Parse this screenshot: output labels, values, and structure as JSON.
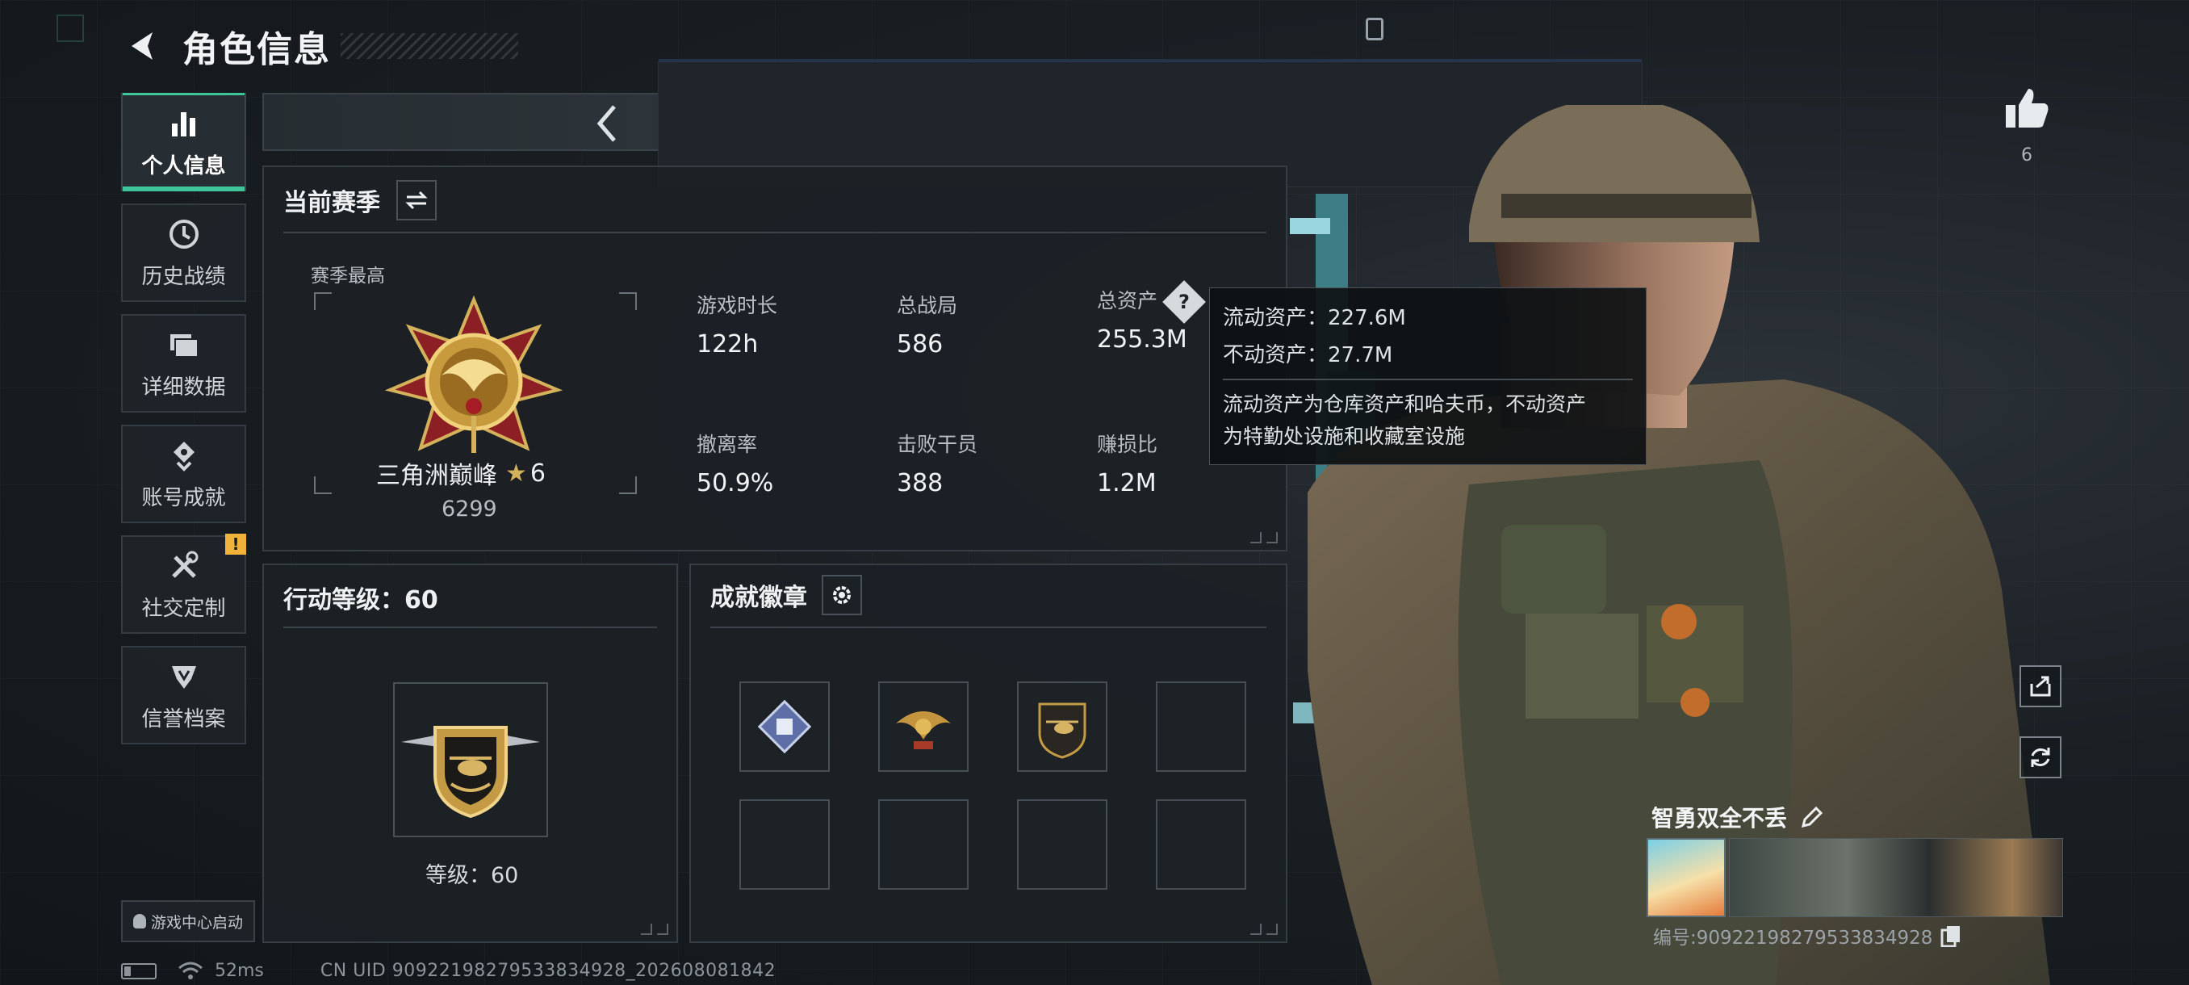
{
  "header": {
    "title": "角色信息"
  },
  "sidebar": {
    "items": [
      {
        "label": "个人信息",
        "icon": "bar-chart-icon",
        "active": true
      },
      {
        "label": "历史战绩",
        "icon": "history-icon"
      },
      {
        "label": "详细数据",
        "icon": "folder-icon"
      },
      {
        "label": "账号成就",
        "icon": "medal-icon"
      },
      {
        "label": "社交定制",
        "icon": "tools-icon",
        "badge": "!"
      },
      {
        "label": "信誉档案",
        "icon": "shield-icon"
      }
    ],
    "game_center": "游戏中心启动"
  },
  "season": {
    "title": "当前赛季",
    "best_label": "赛季最高",
    "rank_name": "三角洲巅峰",
    "rank_stars": "6",
    "rank_score": "6299",
    "stats": [
      {
        "label": "游戏时长",
        "value": "122h"
      },
      {
        "label": "总战局",
        "value": "586"
      },
      {
        "label": "总资产",
        "value": "255.3M"
      },
      {
        "label": "撤离率",
        "value": "50.9%"
      },
      {
        "label": "击败干员",
        "value": "388"
      },
      {
        "label": "赚损比",
        "value": "1.2M"
      }
    ]
  },
  "tooltip": {
    "liquid": "流动资产：227.6M",
    "fixed": "不动资产：27.7M",
    "desc_line1": "流动资产为仓库资产和哈夫币，不动资产",
    "desc_line2": "为特勤处设施和收藏室设施"
  },
  "level": {
    "title": "行动等级：60",
    "level_text": "等级：60"
  },
  "achievements": {
    "title": "成就徽章"
  },
  "profile": {
    "likes": "6",
    "player_name": "智勇双全不丢",
    "player_id": "编号:9092219827953383492​8"
  },
  "status": {
    "ping": "52ms",
    "uid": "CN UID 909221982795338349​28_202608081842"
  },
  "colors": {
    "accent": "#3ec59a",
    "warning": "#f0b23a",
    "gold": "#d4b25b"
  }
}
